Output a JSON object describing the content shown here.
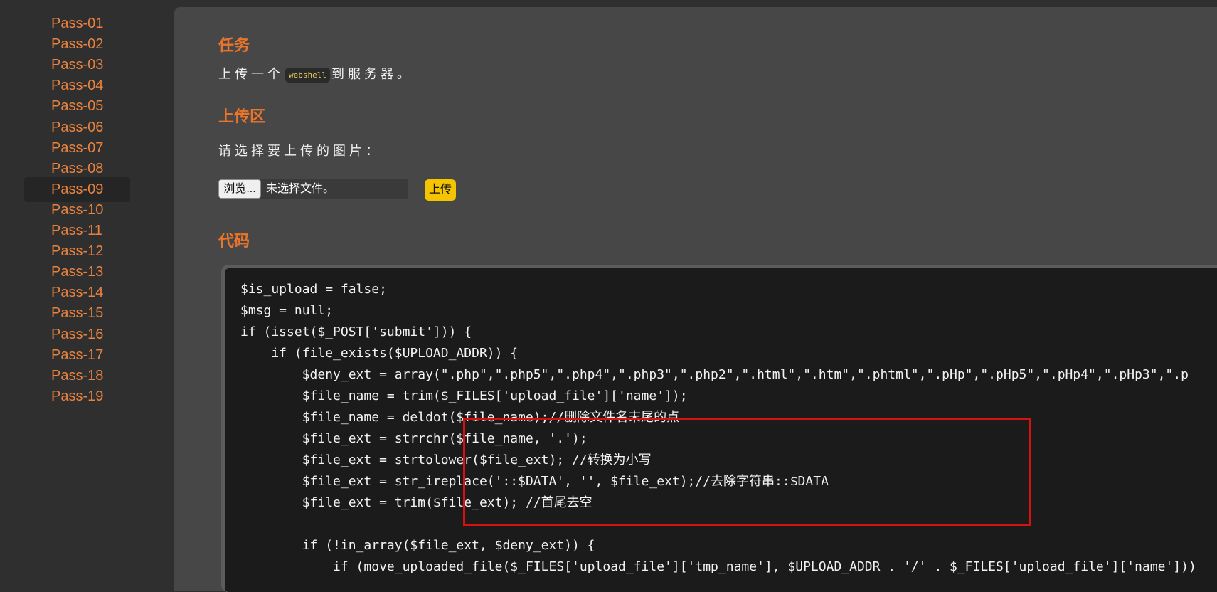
{
  "sidebar": {
    "items": [
      {
        "label": "Pass-01"
      },
      {
        "label": "Pass-02"
      },
      {
        "label": "Pass-03"
      },
      {
        "label": "Pass-04"
      },
      {
        "label": "Pass-05"
      },
      {
        "label": "Pass-06"
      },
      {
        "label": "Pass-07"
      },
      {
        "label": "Pass-08"
      },
      {
        "label": "Pass-09",
        "active": true
      },
      {
        "label": "Pass-10"
      },
      {
        "label": "Pass-11"
      },
      {
        "label": "Pass-12"
      },
      {
        "label": "Pass-13"
      },
      {
        "label": "Pass-14"
      },
      {
        "label": "Pass-15"
      },
      {
        "label": "Pass-16"
      },
      {
        "label": "Pass-17"
      },
      {
        "label": "Pass-18"
      },
      {
        "label": "Pass-19"
      }
    ]
  },
  "task": {
    "heading": "任务",
    "text_before": "上传一个",
    "code_term": "webshell",
    "text_after": "到服务器。"
  },
  "upload": {
    "heading": "上传区",
    "prompt": "请选择要上传的图片：",
    "browse_label": "浏览...",
    "file_status": "未选择文件。",
    "submit_label": "上传"
  },
  "code": {
    "heading": "代码",
    "lines": [
      "$is_upload = false;",
      "$msg = null;",
      "if (isset($_POST['submit'])) {",
      "    if (file_exists($UPLOAD_ADDR)) {",
      "        $deny_ext = array(\".php\",\".php5\",\".php4\",\".php3\",\".php2\",\".html\",\".htm\",\".phtml\",\".pHp\",\".pHp5\",\".pHp4\",\".pHp3\",\".p",
      "        $file_name = trim($_FILES['upload_file']['name']);",
      "        $file_name = deldot($file_name);//删除文件名末尾的点",
      "        $file_ext = strrchr($file_name, '.');",
      "        $file_ext = strtolower($file_ext); //转换为小写",
      "        $file_ext = str_ireplace('::$DATA', '', $file_ext);//去除字符串::$DATA",
      "        $file_ext = trim($file_ext); //首尾去空",
      "",
      "        if (!in_array($file_ext, $deny_ext)) {",
      "            if (move_uploaded_file($_FILES['upload_file']['tmp_name'], $UPLOAD_ADDR . '/' . $_FILES['upload_file']['name']))"
    ]
  },
  "colors": {
    "accent": "#e8752a",
    "sidebar_link": "#e8823f",
    "upload_button": "#f5c400",
    "highlight_border": "#d81010"
  }
}
